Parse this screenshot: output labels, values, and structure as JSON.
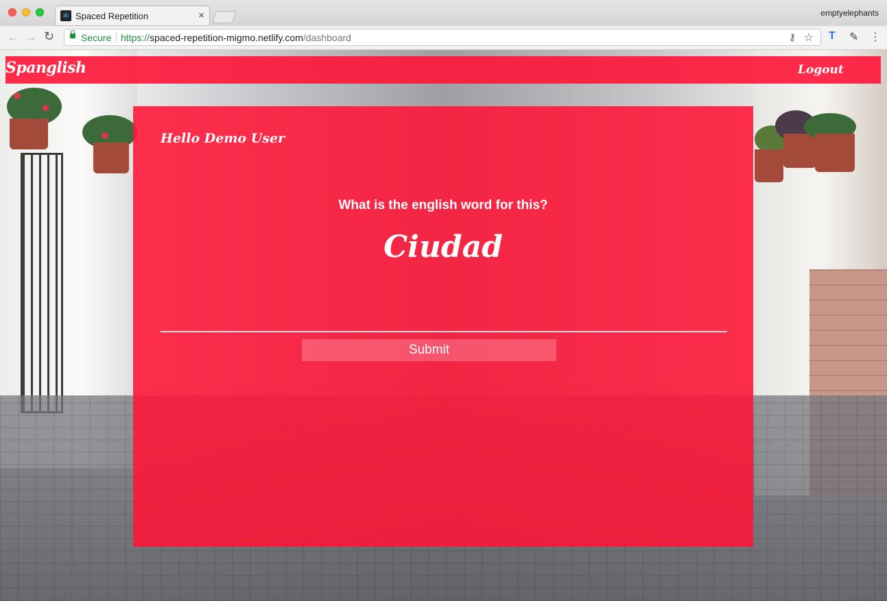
{
  "browser": {
    "tab_title": "Spaced Repetition",
    "tab_close": "×",
    "profile_name": "emptyelephants",
    "secure_label": "Secure",
    "url_scheme": "https://",
    "url_host": "spaced-repetition-migmo.netlify.com",
    "url_path": "/dashboard",
    "icons": {
      "back": "←",
      "forward": "→",
      "reload": "↻",
      "key": "⚷",
      "star": "☆",
      "typo_ext": "T",
      "pen_ext": "✎",
      "menu": "⋮",
      "favicon": "⚛"
    }
  },
  "nav": {
    "brand": "Spanglish",
    "logout": "Logout"
  },
  "card": {
    "greeting": "Hello Demo User",
    "prompt": "What is the english word for this?",
    "word": "Ciudad",
    "answer_value": "",
    "submit_label": "Submit"
  },
  "colors": {
    "accent": "#ff1437",
    "text": "#ffffff"
  }
}
